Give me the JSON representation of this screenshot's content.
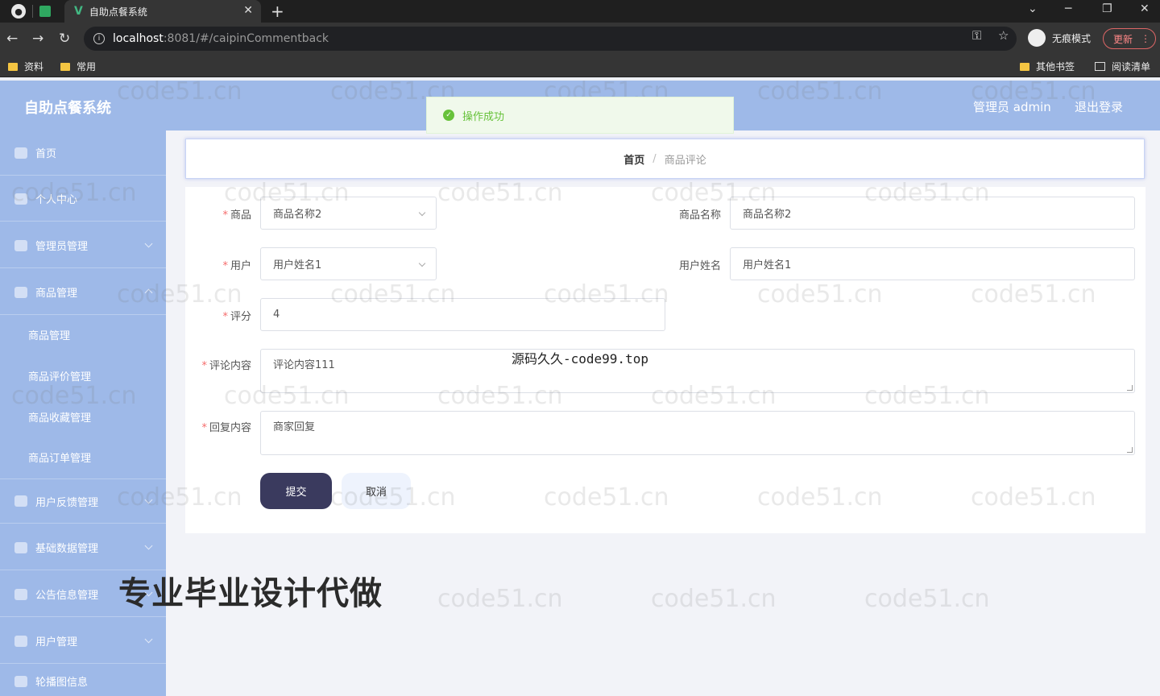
{
  "browser": {
    "tab_title": "自助点餐系统",
    "url_host": "localhost",
    "url_rest": ":8081/#/caipinCommentback",
    "incognito_label": "无痕模式",
    "update_label": "更新",
    "bookmarks": [
      "资料",
      "常用"
    ],
    "other_bookmarks": "其他书签",
    "reading_list": "阅读清单"
  },
  "header": {
    "title": "自助点餐系统",
    "admin_label": "管理员 admin",
    "logout_label": "退出登录"
  },
  "toast": {
    "message": "操作成功",
    "color": "#67c23a"
  },
  "sidebar": {
    "items": [
      {
        "label": "首页"
      },
      {
        "label": "个人中心"
      },
      {
        "label": "管理员管理"
      },
      {
        "label": "商品管理"
      },
      {
        "label": "用户反馈管理"
      },
      {
        "label": "基础数据管理"
      },
      {
        "label": "公告信息管理"
      },
      {
        "label": "用户管理"
      },
      {
        "label": "轮播图信息"
      }
    ],
    "sub_items": [
      {
        "label": "商品管理"
      },
      {
        "label": "商品评价管理"
      },
      {
        "label": "商品收藏管理"
      },
      {
        "label": "商品订单管理"
      }
    ]
  },
  "breadcrumb": {
    "home": "首页",
    "separator": "/",
    "current": "商品评论"
  },
  "form": {
    "product_label": "商品",
    "product_value": "商品名称2",
    "product_name_label": "商品名称",
    "product_name_value": "商品名称2",
    "user_label": "用户",
    "user_value": "用户姓名1",
    "user_name_label": "用户姓名",
    "user_name_value": "用户姓名1",
    "rating_label": "评分",
    "rating_value": "4",
    "comment_label": "评论内容",
    "comment_value": "评论内容111",
    "reply_label": "回复内容",
    "reply_value": "商家回复",
    "required_mark": "*",
    "submit_label": "提交",
    "cancel_label": "取消"
  },
  "overlays": {
    "source_text": "源码久久-code99.top",
    "promo_text": "专业毕业设计代做",
    "watermark": "code51.cn"
  },
  "colors": {
    "header_bg": "#9eb9e8",
    "submit_bg": "#3a3a5e",
    "required": "#f56c6c"
  }
}
